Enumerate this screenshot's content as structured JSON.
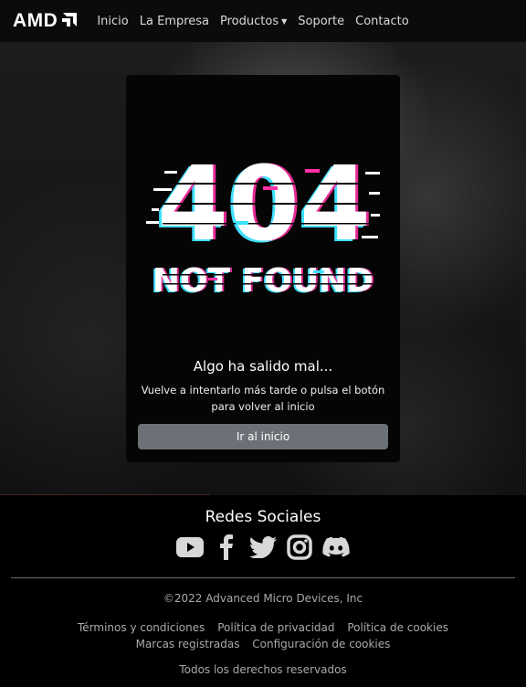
{
  "nav": {
    "logo_text": "AMD",
    "links": [
      "Inicio",
      "La Empresa",
      "Productos",
      "Soporte",
      "Contacto"
    ]
  },
  "error_card": {
    "code": "404",
    "subtitle": "NOT FOUND",
    "title": "Algo ha salido mal...",
    "text_line1": "Vuelve a intentarlo más tarde o pulsa el botón",
    "text_line2": "para volver al inicio",
    "button_label": "Ir al inicio"
  },
  "footer": {
    "social_title": "Redes Sociales",
    "social_icons": [
      "youtube-icon",
      "facebook-icon",
      "twitter-icon",
      "instagram-icon",
      "discord-icon"
    ],
    "copyright": "©2022 Advanced Micro Devices, Inc",
    "links": [
      "Términos y condiciones",
      "Política de privacidad",
      "Política de cookies",
      "Marcas registradas",
      "Configuración de cookies"
    ],
    "rights": "Todos los derechos reservados"
  },
  "colors": {
    "glitch_cyan": "#3fe0ff",
    "glitch_magenta": "#ff2fa6",
    "button_gray": "#6c7177",
    "footer_text": "#a9a9a9"
  }
}
